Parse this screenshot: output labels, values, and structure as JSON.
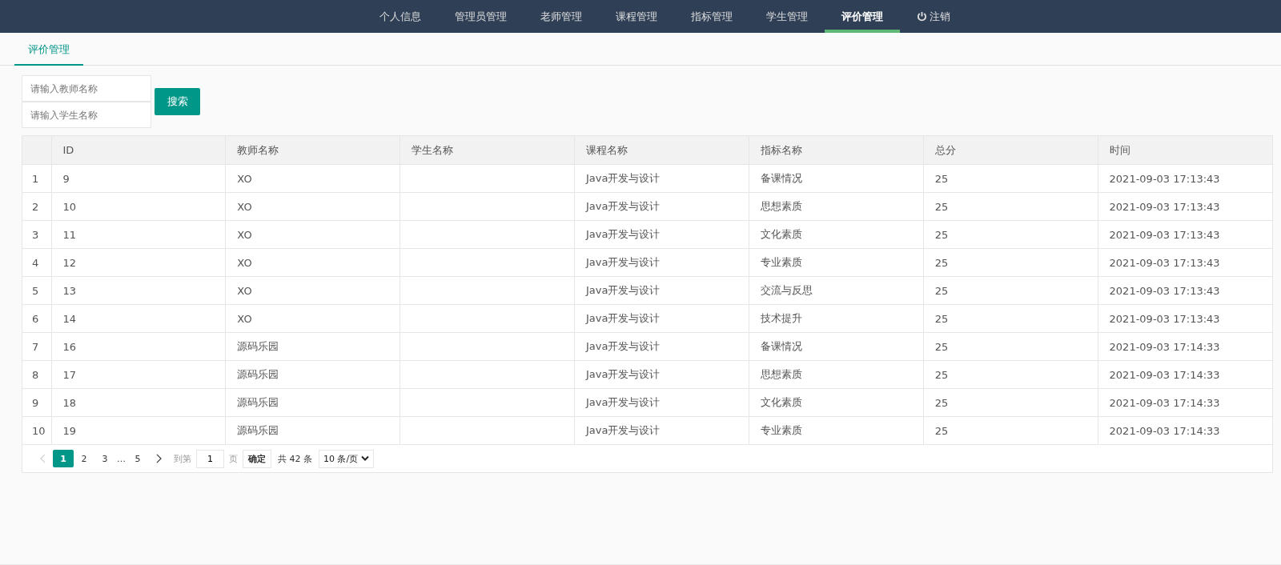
{
  "nav": {
    "items": [
      {
        "label": "个人信息",
        "kind": "link",
        "selected": false
      },
      {
        "label": "管理员管理",
        "kind": "link",
        "selected": false
      },
      {
        "label": "老师管理",
        "kind": "link",
        "selected": false
      },
      {
        "label": "课程管理",
        "kind": "link",
        "selected": false
      },
      {
        "label": "指标管理",
        "kind": "link",
        "selected": false
      },
      {
        "label": "学生管理",
        "kind": "link",
        "selected": false
      },
      {
        "label": "评价管理",
        "kind": "link",
        "selected": true
      },
      {
        "label": "注销",
        "kind": "logout",
        "selected": false
      }
    ]
  },
  "tabs": [
    {
      "label": "评价管理",
      "selected": true
    }
  ],
  "search": {
    "fields": [
      {
        "placeholder": "请输入教师名称"
      },
      {
        "placeholder": "请输入学生名称"
      }
    ],
    "button": "搜索"
  },
  "table": {
    "columns": [
      "",
      "ID",
      "教师名称",
      "学生名称",
      "课程名称",
      "指标名称",
      "总分",
      "时间"
    ],
    "rows": [
      [
        "1",
        "9",
        "XO",
        "",
        "Java开发与设计",
        "备课情况",
        "25",
        "2021-09-03 17:13:43"
      ],
      [
        "2",
        "10",
        "XO",
        "",
        "Java开发与设计",
        "思想素质",
        "25",
        "2021-09-03 17:13:43"
      ],
      [
        "3",
        "11",
        "XO",
        "",
        "Java开发与设计",
        "文化素质",
        "25",
        "2021-09-03 17:13:43"
      ],
      [
        "4",
        "12",
        "XO",
        "",
        "Java开发与设计",
        "专业素质",
        "25",
        "2021-09-03 17:13:43"
      ],
      [
        "5",
        "13",
        "XO",
        "",
        "Java开发与设计",
        "交流与反思",
        "25",
        "2021-09-03 17:13:43"
      ],
      [
        "6",
        "14",
        "XO",
        "",
        "Java开发与设计",
        "技术提升",
        "25",
        "2021-09-03 17:13:43"
      ],
      [
        "7",
        "16",
        "源码乐园",
        "",
        "Java开发与设计",
        "备课情况",
        "25",
        "2021-09-03 17:14:33"
      ],
      [
        "8",
        "17",
        "源码乐园",
        "",
        "Java开发与设计",
        "思想素质",
        "25",
        "2021-09-03 17:14:33"
      ],
      [
        "9",
        "18",
        "源码乐园",
        "",
        "Java开发与设计",
        "文化素质",
        "25",
        "2021-09-03 17:14:33"
      ],
      [
        "10",
        "19",
        "源码乐园",
        "",
        "Java开发与设计",
        "专业素质",
        "25",
        "2021-09-03 17:14:33"
      ]
    ]
  },
  "pagination": {
    "prev_disabled": true,
    "pages": [
      {
        "label": "1",
        "kind": "page",
        "selected": true
      },
      {
        "label": "2",
        "kind": "page",
        "selected": false
      },
      {
        "label": "3",
        "kind": "page",
        "selected": false
      },
      {
        "label": "…",
        "kind": "ellipsis"
      },
      {
        "label": "5",
        "kind": "page",
        "selected": false
      }
    ],
    "goto_label": "到第",
    "goto_value": "1",
    "page_unit": "页",
    "confirm": "确定",
    "total": "共 42 条",
    "page_size": "10 条/页"
  }
}
